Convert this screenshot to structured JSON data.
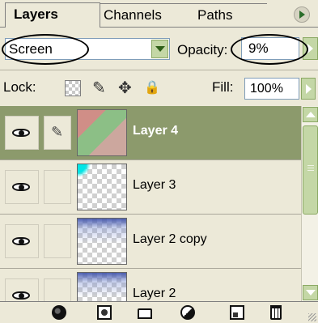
{
  "tabs": {
    "layers": "Layers",
    "channels": "Channels",
    "paths": "Paths"
  },
  "blend": {
    "mode": "Screen",
    "opacity_label": "Opacity:",
    "opacity_value": "9%"
  },
  "lock": {
    "label": "Lock:",
    "fill_label": "Fill:",
    "fill_value": "100%"
  },
  "layers": [
    {
      "name": "Layer 4",
      "selected": true
    },
    {
      "name": "Layer 3",
      "selected": false
    },
    {
      "name": "Layer 2 copy",
      "selected": false
    },
    {
      "name": "Layer 2",
      "selected": false
    }
  ],
  "colors": {
    "selection": "#8c9a6c",
    "accent": "#c4d7a6"
  },
  "icons": {
    "visibility": "eye-icon",
    "brush": "brush-icon",
    "move": "move-icon",
    "lock": "lock-icon",
    "link": "link-icon",
    "mask": "add-mask-icon",
    "folder": "new-group-icon",
    "adjustment": "adjustment-layer-icon",
    "new_layer": "new-layer-icon",
    "trash": "delete-layer-icon"
  }
}
